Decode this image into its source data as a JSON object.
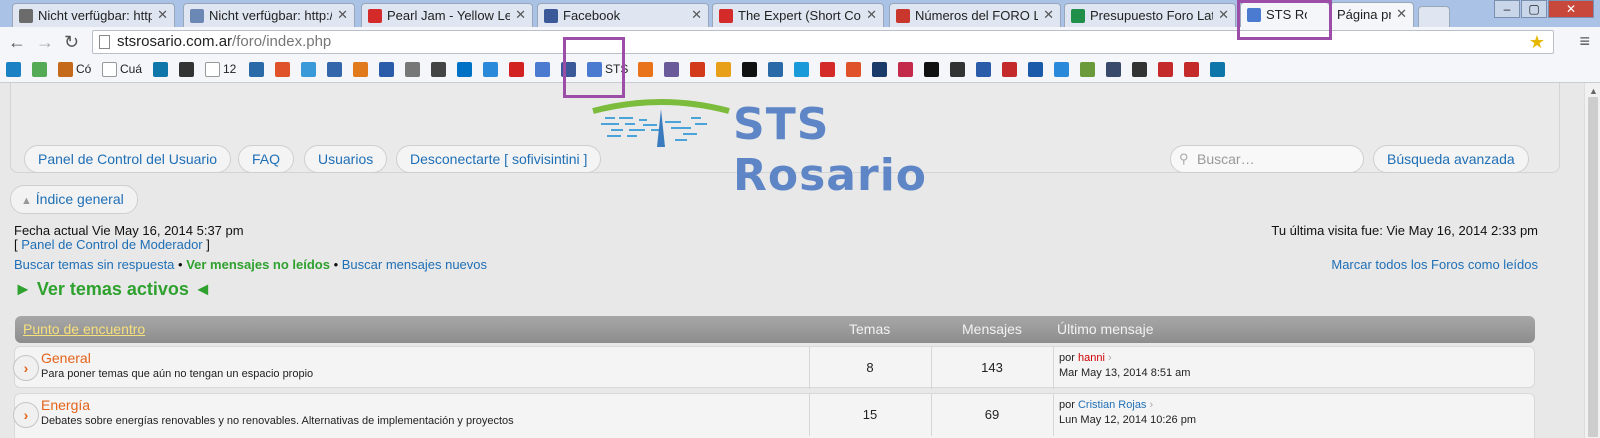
{
  "browser": {
    "tabs": [
      {
        "title": "Nicht verfügbar: http://",
        "color": "#6b6b6b"
      },
      {
        "title": "Nicht verfügbar: http://",
        "color": "#6b88b5"
      },
      {
        "title": "Pearl Jam - Yellow Le",
        "color": "#d42a2a"
      },
      {
        "title": "Facebook",
        "color": "#3b5998"
      },
      {
        "title": "The Expert (Short Come",
        "color": "#d42a2a"
      },
      {
        "title": "Números del FORO LAT",
        "color": "#c9362b"
      },
      {
        "title": "Presupuesto Foro Latin",
        "color": "#1f8f4a"
      },
      {
        "title": "STS Rosario",
        "color": "#4a7bd0"
      },
      {
        "title": "Página pri",
        "color": ""
      }
    ],
    "url_host": "stsrosario.com.ar",
    "url_path": "/foro/index.php",
    "bookmarks": [
      {
        "label": "",
        "color": "#1a82c4"
      },
      {
        "label": "",
        "color": "#55aa55"
      },
      {
        "label": "Có",
        "color": "#c46a1a"
      },
      {
        "label": "Cuá",
        "color": "#ffffff"
      },
      {
        "label": "",
        "color": "#0e76a8"
      },
      {
        "label": "",
        "color": "#333333"
      },
      {
        "label": "12",
        "color": "#ffffff"
      },
      {
        "label": "",
        "color": "#2a6aa8"
      },
      {
        "label": "",
        "color": "#e0522a"
      },
      {
        "label": "",
        "color": "#3a9ad9"
      },
      {
        "label": "",
        "color": "#3366aa"
      },
      {
        "label": "",
        "color": "#e07a1a"
      },
      {
        "label": "",
        "color": "#2a5caa"
      },
      {
        "label": "",
        "color": "#777777"
      },
      {
        "label": "",
        "color": "#444444"
      },
      {
        "label": "",
        "color": "#0072c6"
      },
      {
        "label": "",
        "color": "#2a8ad9"
      },
      {
        "label": "",
        "color": "#d22222"
      },
      {
        "label": "",
        "color": "#4a7bd0"
      },
      {
        "label": "",
        "color": "#3b5998"
      },
      {
        "label": "STS",
        "color": "#4a7bd0"
      },
      {
        "label": "",
        "color": "#e8731a"
      },
      {
        "label": "",
        "color": "#6a5a9a"
      },
      {
        "label": "",
        "color": "#d23a1a"
      },
      {
        "label": "",
        "color": "#e8a01a"
      },
      {
        "label": "",
        "color": "#111111"
      },
      {
        "label": "",
        "color": "#2a6aa8"
      },
      {
        "label": "",
        "color": "#1a9ad9"
      },
      {
        "label": "",
        "color": "#d42a2a"
      },
      {
        "label": "",
        "color": "#e0522a"
      },
      {
        "label": "",
        "color": "#1a3a6a"
      },
      {
        "label": "",
        "color": "#c42a4a"
      },
      {
        "label": "",
        "color": "#111111"
      },
      {
        "label": "",
        "color": "#333333"
      },
      {
        "label": "",
        "color": "#2a5caa"
      },
      {
        "label": "",
        "color": "#c42a2a"
      },
      {
        "label": "",
        "color": "#1a5aa8"
      },
      {
        "label": "",
        "color": "#2a8ad9"
      },
      {
        "label": "",
        "color": "#6a9a3a"
      },
      {
        "label": "",
        "color": "#3a4a6a"
      },
      {
        "label": "",
        "color": "#333333"
      },
      {
        "label": "",
        "color": "#c42a2a"
      },
      {
        "label": "",
        "color": "#c42a2a"
      },
      {
        "label": "",
        "color": "#0e76a8"
      }
    ]
  },
  "site": {
    "logo_text": "STS Rosario",
    "nav": {
      "panel": "Panel de Control del Usuario",
      "faq": "FAQ",
      "users": "Usuarios",
      "logout": "Desconectarte [ sofivisintini ]",
      "search_placeholder": "Buscar…",
      "advanced": "Búsqueda avanzada"
    },
    "index_link": "Índice general",
    "current_date": "Fecha actual Vie May 16, 2014 5:37 pm",
    "last_visit": "Tu última visita fue: Vie May 16, 2014 2:33 pm",
    "mod_panel": "Panel de Control de Moderador",
    "links": {
      "unanswered": "Buscar temas sin respuesta",
      "unread": "Ver mensajes no leídos",
      "new": "Buscar mensajes nuevos",
      "mark_read": "Marcar todos los Foros como leídos"
    },
    "active_topics": "► Ver temas activos ◄",
    "forum_table": {
      "category": "Punto de encuentro",
      "col_topics": "Temas",
      "col_posts": "Mensajes",
      "col_last": "Último mensaje",
      "rows": [
        {
          "title": "General",
          "desc": "Para poner temas que aún no tengan un espacio propio",
          "topics": "8",
          "posts": "143",
          "by": "por",
          "author": "hanni",
          "author_color": "#d00000",
          "date": "Mar May 13, 2014 8:51 am"
        },
        {
          "title": "Energía",
          "desc": "Debates sobre energías renovables y no renovables. Alternativas de implementación y proyectos",
          "topics": "15",
          "posts": "69",
          "by": "por",
          "author": "Cristian Rojas",
          "author_color": "#1f6fb6",
          "date": "Lun May 12, 2014 10:26 pm"
        }
      ]
    }
  }
}
